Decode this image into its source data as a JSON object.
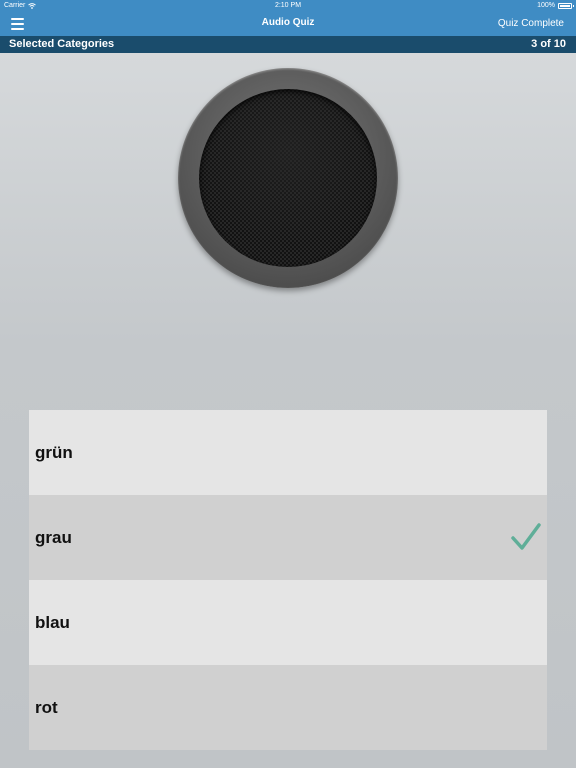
{
  "status_bar": {
    "carrier": "Carrier",
    "time": "2:10 PM",
    "battery": "100%"
  },
  "nav": {
    "title": "Audio Quiz",
    "right_button": "Quiz Complete",
    "menu_icon": "hamburger-menu-icon"
  },
  "subheader": {
    "category": "Selected Categories",
    "progress": "3 of 10"
  },
  "speaker": {
    "icon": "speaker-icon"
  },
  "answers": [
    {
      "label": "grün",
      "selected": false
    },
    {
      "label": "grau",
      "selected": true
    },
    {
      "label": "blau",
      "selected": false
    },
    {
      "label": "rot",
      "selected": false
    }
  ],
  "colors": {
    "nav_bg": "#3f8cc4",
    "subheader_bg": "#1a4c6c",
    "check": "#5fae98"
  }
}
